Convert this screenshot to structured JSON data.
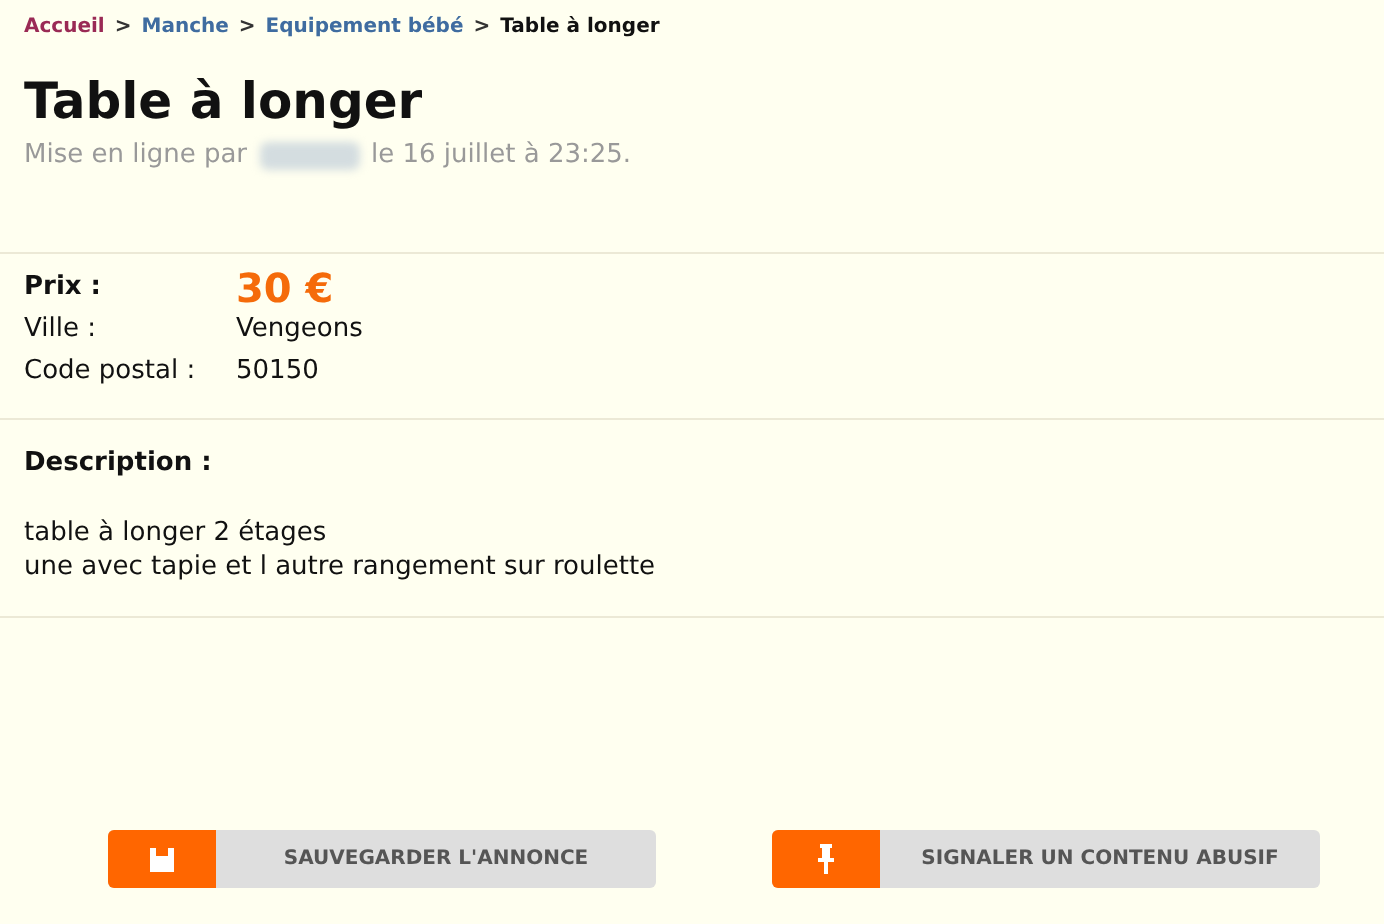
{
  "breadcrumb": [
    {
      "label": "Accueil",
      "color": "#9a2a55"
    },
    {
      "label": "Manche",
      "color": "#3f6ca0"
    },
    {
      "label": "Equipement bébé",
      "color": "#3f6ca0"
    },
    {
      "label": "Table à longer",
      "color": "#111111"
    }
  ],
  "breadcrumb_separator": ">",
  "title": "Table à longer",
  "posted": {
    "prefix": "Mise en ligne par",
    "suffix": "le 16 juillet à 23:25."
  },
  "details": [
    {
      "label": "Prix :",
      "value": "30 €",
      "kind": "price"
    },
    {
      "label": "Ville :",
      "value": "Vengeons",
      "kind": "plain"
    },
    {
      "label": "Code postal :",
      "value": "50150",
      "kind": "plain"
    }
  ],
  "description": {
    "heading": "Description :",
    "lines": [
      "table à longer 2 étages",
      "une avec tapie et l autre rangement sur roulette"
    ]
  },
  "buttons": [
    {
      "label": "SAUVEGARDER L'ANNONCE",
      "kind": "save"
    },
    {
      "label": "SIGNALER UN CONTENU ABUSIF",
      "kind": "report"
    }
  ]
}
